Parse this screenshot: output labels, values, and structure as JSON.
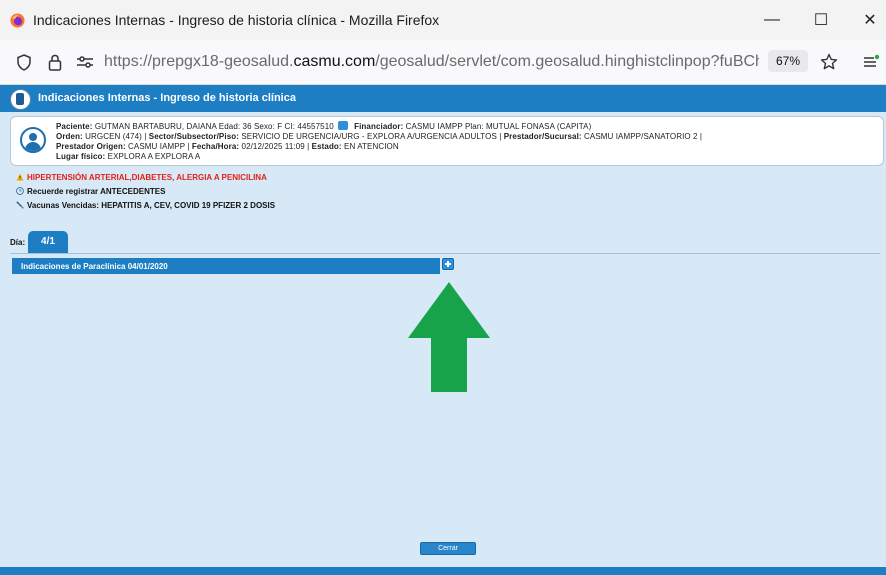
{
  "window": {
    "title": "Indicaciones Internas - Ingreso de historia clínica - Mozilla Firefox",
    "minimize_glyph": "—",
    "maximize_glyph": "☐",
    "close_glyph": "✕"
  },
  "urlbar": {
    "url_prefix": "https://prepgx18-geosalud.",
    "url_domain": "casmu.com",
    "url_suffix": "/geosalud/servlet/com.geosalud.hinghistclinpop?fuBChUpFQZc",
    "zoom": "67%"
  },
  "header": {
    "title": "Indicaciones Internas - Ingreso de historia clínica"
  },
  "patient": {
    "line1": {
      "paciente_label": "Paciente:",
      "paciente_value": "GUTMAN BARTABURU, DAIANA Edad: 36 Sexo: F CI: 44557510",
      "financiador_label": "Financiador:",
      "financiador_value": "CASMU IAMPP Plan: MUTUAL FONASA (CAPITA)"
    },
    "line2": {
      "orden_label": "Orden:",
      "orden_value": "URGCEN (474) |",
      "sector_label": "Sector/Subsector/Piso:",
      "sector_value": "SERVICIO DE URGENCIA/URG - EXPLORA A/URGENCIA ADULTOS |",
      "prestador_label": "Prestador/Sucursal:",
      "prestador_value": "CASMU IAMPP/SANATORIO 2 |"
    },
    "line3": {
      "origen_label": "Prestador Origen:",
      "origen_value": "CASMU IAMPP |",
      "fecha_label": "Fecha/Hora:",
      "fecha_value": "02/12/2025 11:09 |",
      "estado_label": "Estado:",
      "estado_value": "EN ATENCION"
    },
    "line4": {
      "lugar_label": "Lugar físico:",
      "lugar_value": "EXPLORA A EXPLORA A"
    }
  },
  "alerts": {
    "conditions": "HIPERTENSIÓN ARTERIAL,DIABETES, ALERGIA A PENICILINA",
    "reminder": "Recuerde registrar ANTECEDENTES",
    "vaccines": "Vacunas Vencidas: HEPATITIS A, CEV, COVID 19 PFIZER 2 DOSIS"
  },
  "day": {
    "label": "Día:",
    "tab": "4/1"
  },
  "panel": {
    "title": "Indicaciones de Paraclínica 04/01/2020"
  },
  "footer": {
    "close_label": "Cerrar"
  },
  "colors": {
    "accent": "#1d7ec3",
    "alert_red": "#e0211b",
    "arrow_green": "#16a34a"
  }
}
